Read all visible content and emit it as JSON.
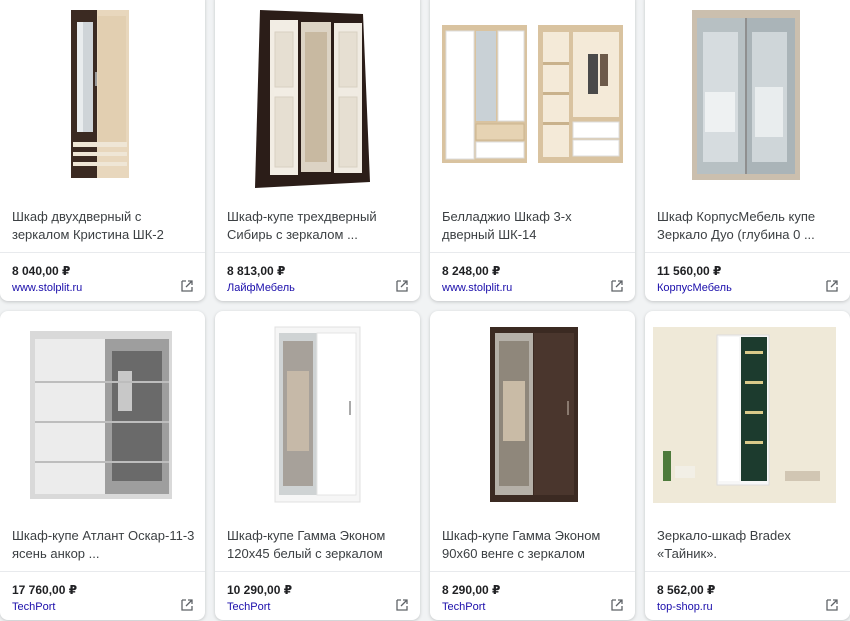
{
  "products": [
    {
      "title": "Шкаф двухдверный с зеркалом Кристина ШК-2",
      "price": "8 040,00 ₽",
      "seller": "www.stolplit.ru",
      "icon": "external-link-icon"
    },
    {
      "title": "Шкаф-купе трехдверный Сибирь с зеркалом ...",
      "price": "8 813,00 ₽",
      "seller": "ЛайфМебель",
      "icon": "external-link-icon"
    },
    {
      "title": "Белладжио Шкаф 3-х дверный ШК-14",
      "price": "8 248,00 ₽",
      "seller": "www.stolplit.ru",
      "icon": "external-link-icon"
    },
    {
      "title": "Шкаф КорпусМебель купе Зеркало Дуо (глубина 0 ...",
      "price": "11 560,00 ₽",
      "seller": "КорпусМебель",
      "icon": "external-link-icon"
    },
    {
      "title": "Шкаф-купе Атлант Оскар-11-3 ясень анкор ...",
      "price": "17 760,00 ₽",
      "seller": "TechPort",
      "icon": "external-link-icon"
    },
    {
      "title": "Шкаф-купе Гамма Эконом 120х45 белый с зеркалом",
      "price": "10 290,00 ₽",
      "seller": "TechPort",
      "icon": "external-link-icon"
    },
    {
      "title": "Шкаф-купе Гамма Эконом 90х60 венге с зеркалом",
      "price": "8 290,00 ₽",
      "seller": "TechPort",
      "icon": "external-link-icon"
    },
    {
      "title": "Зеркало-шкаф Bradex «Тайник».",
      "price": "8 562,00 ₽",
      "seller": "top-shop.ru",
      "icon": "external-link-icon"
    }
  ],
  "colors": {
    "link": "#1a0dab",
    "title": "#3c4043",
    "price": "#202124",
    "background": "#f1f3f4"
  }
}
